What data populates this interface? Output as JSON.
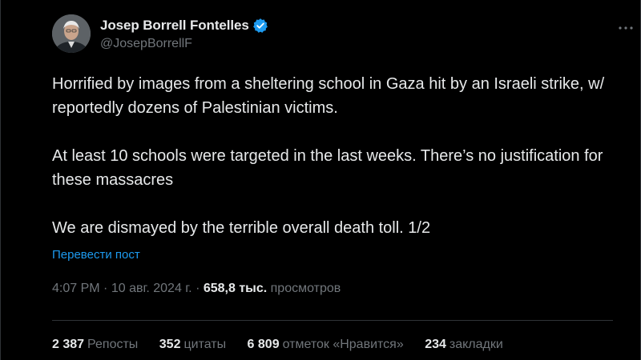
{
  "author": {
    "display_name": "Josep Borrell Fontelles",
    "handle": "@JosepBorrellF",
    "verified": true,
    "badge_color": "#1d9bf0"
  },
  "tweet": {
    "paragraphs": [
      "Horrified by images from a sheltering school in Gaza hit by an Israeli strike, w/ reportedly dozens of Palestinian victims.",
      "At least 10 schools were targeted in the last weeks. There’s no justification for these massacres",
      "We are dismayed by the terrible overall death toll. 1/2"
    ],
    "translate_label": "Перевести пост",
    "time": "4:07 PM",
    "date": "10 авг. 2024 г.",
    "views_count": "658,8 тыс.",
    "views_label": "просмотров"
  },
  "stats": [
    {
      "count": "2 387",
      "label": "Репосты"
    },
    {
      "count": "352",
      "label": "цитаты"
    },
    {
      "count": "6 809",
      "label": "отметок «Нравится»"
    },
    {
      "count": "234",
      "label": "закладки"
    }
  ],
  "icons": {
    "verified": "verified-badge-icon",
    "more": "more-options-icon"
  },
  "colors": {
    "background": "#000000",
    "text": "#e7e9ea",
    "muted": "#71767b",
    "link": "#1d9bf0"
  }
}
